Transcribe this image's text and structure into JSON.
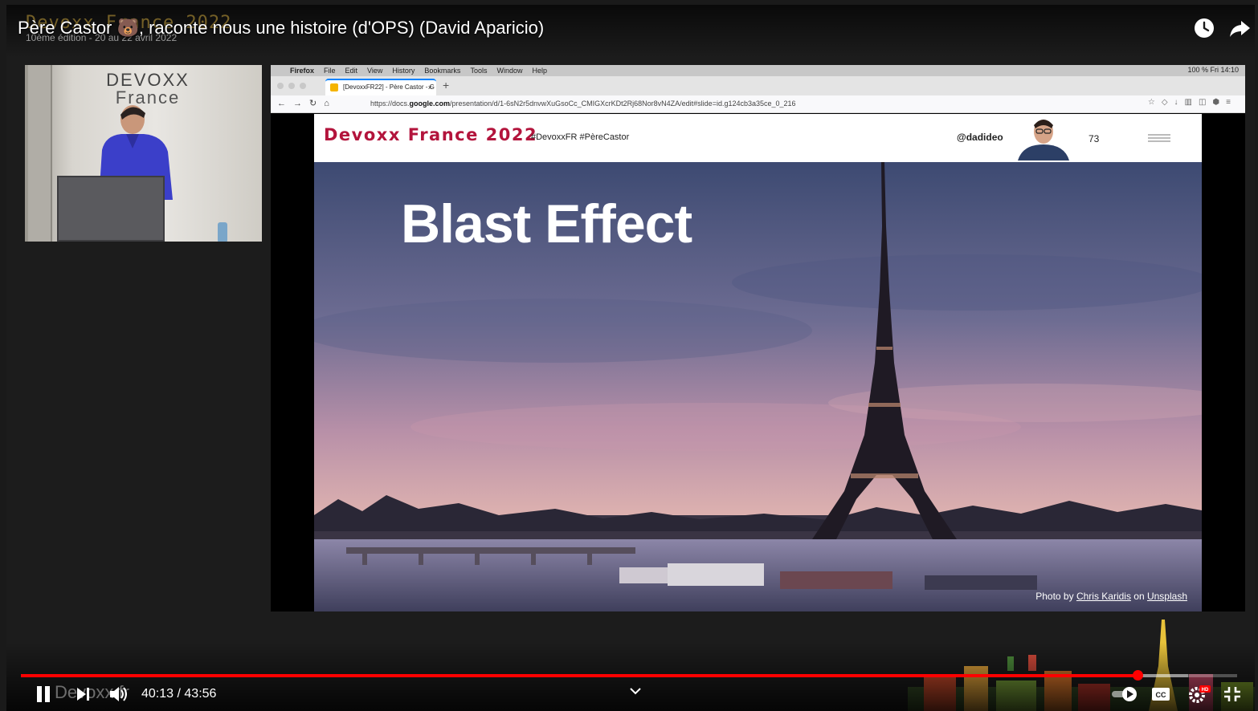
{
  "video": {
    "title": "Père Castor 🐻, raconte nous une histoire (d'OPS) (David Aparicio)",
    "time_current": "40:13",
    "time_separator": " / ",
    "time_total": "43:56",
    "progress_fraction": 0.918,
    "buffer_fraction": 0.96
  },
  "watermark": {
    "conference": "Devoxx France 2022",
    "edition": "10ème édition - 20 au 22 avril 2022",
    "channel": "Devoxx fr"
  },
  "speaker_cam": {
    "logo_line1": "DEVOXX",
    "logo_line2": "France"
  },
  "browser": {
    "menubar": {
      "app": "Firefox",
      "items": [
        "File",
        "Edit",
        "View",
        "History",
        "Bookmarks",
        "Tools",
        "Window",
        "Help"
      ],
      "status_right": "100 %   Fri 14:10"
    },
    "tab_title": "[DevoxxFR22] - Père Castor - G",
    "url_prefix": "https://docs.",
    "url_domain": "google.com",
    "url_path": "/presentation/d/1-6sN2r5dnvwXuGsoCc_CMIGXcrKDt2Rj68Nor8vN4ZA/edit#slide=id.g124cb3a35ce_0_216"
  },
  "slide": {
    "brand": "Devoxx France 2022",
    "hashtags": "#DevoxxFR #PèreCastor",
    "handle": "@dadideo",
    "number": "73",
    "title": "Blast Effect",
    "credit_prefix": "Photo by ",
    "credit_author": "Chris Karidis",
    "credit_mid": " on ",
    "credit_site": "Unsplash"
  },
  "colors": {
    "progress": "#ff0000",
    "brand": "#b3143c"
  },
  "icons": {
    "watch_later": "clock-icon",
    "share": "share-arrow-icon",
    "play_pause": "pause-icon",
    "next": "next-icon",
    "volume": "volume-icon",
    "autoplay": "autoplay-toggle-icon",
    "captions": "cc-icon",
    "settings": "gear-hd-icon",
    "exit_fullscreen": "exit-fullscreen-icon"
  }
}
